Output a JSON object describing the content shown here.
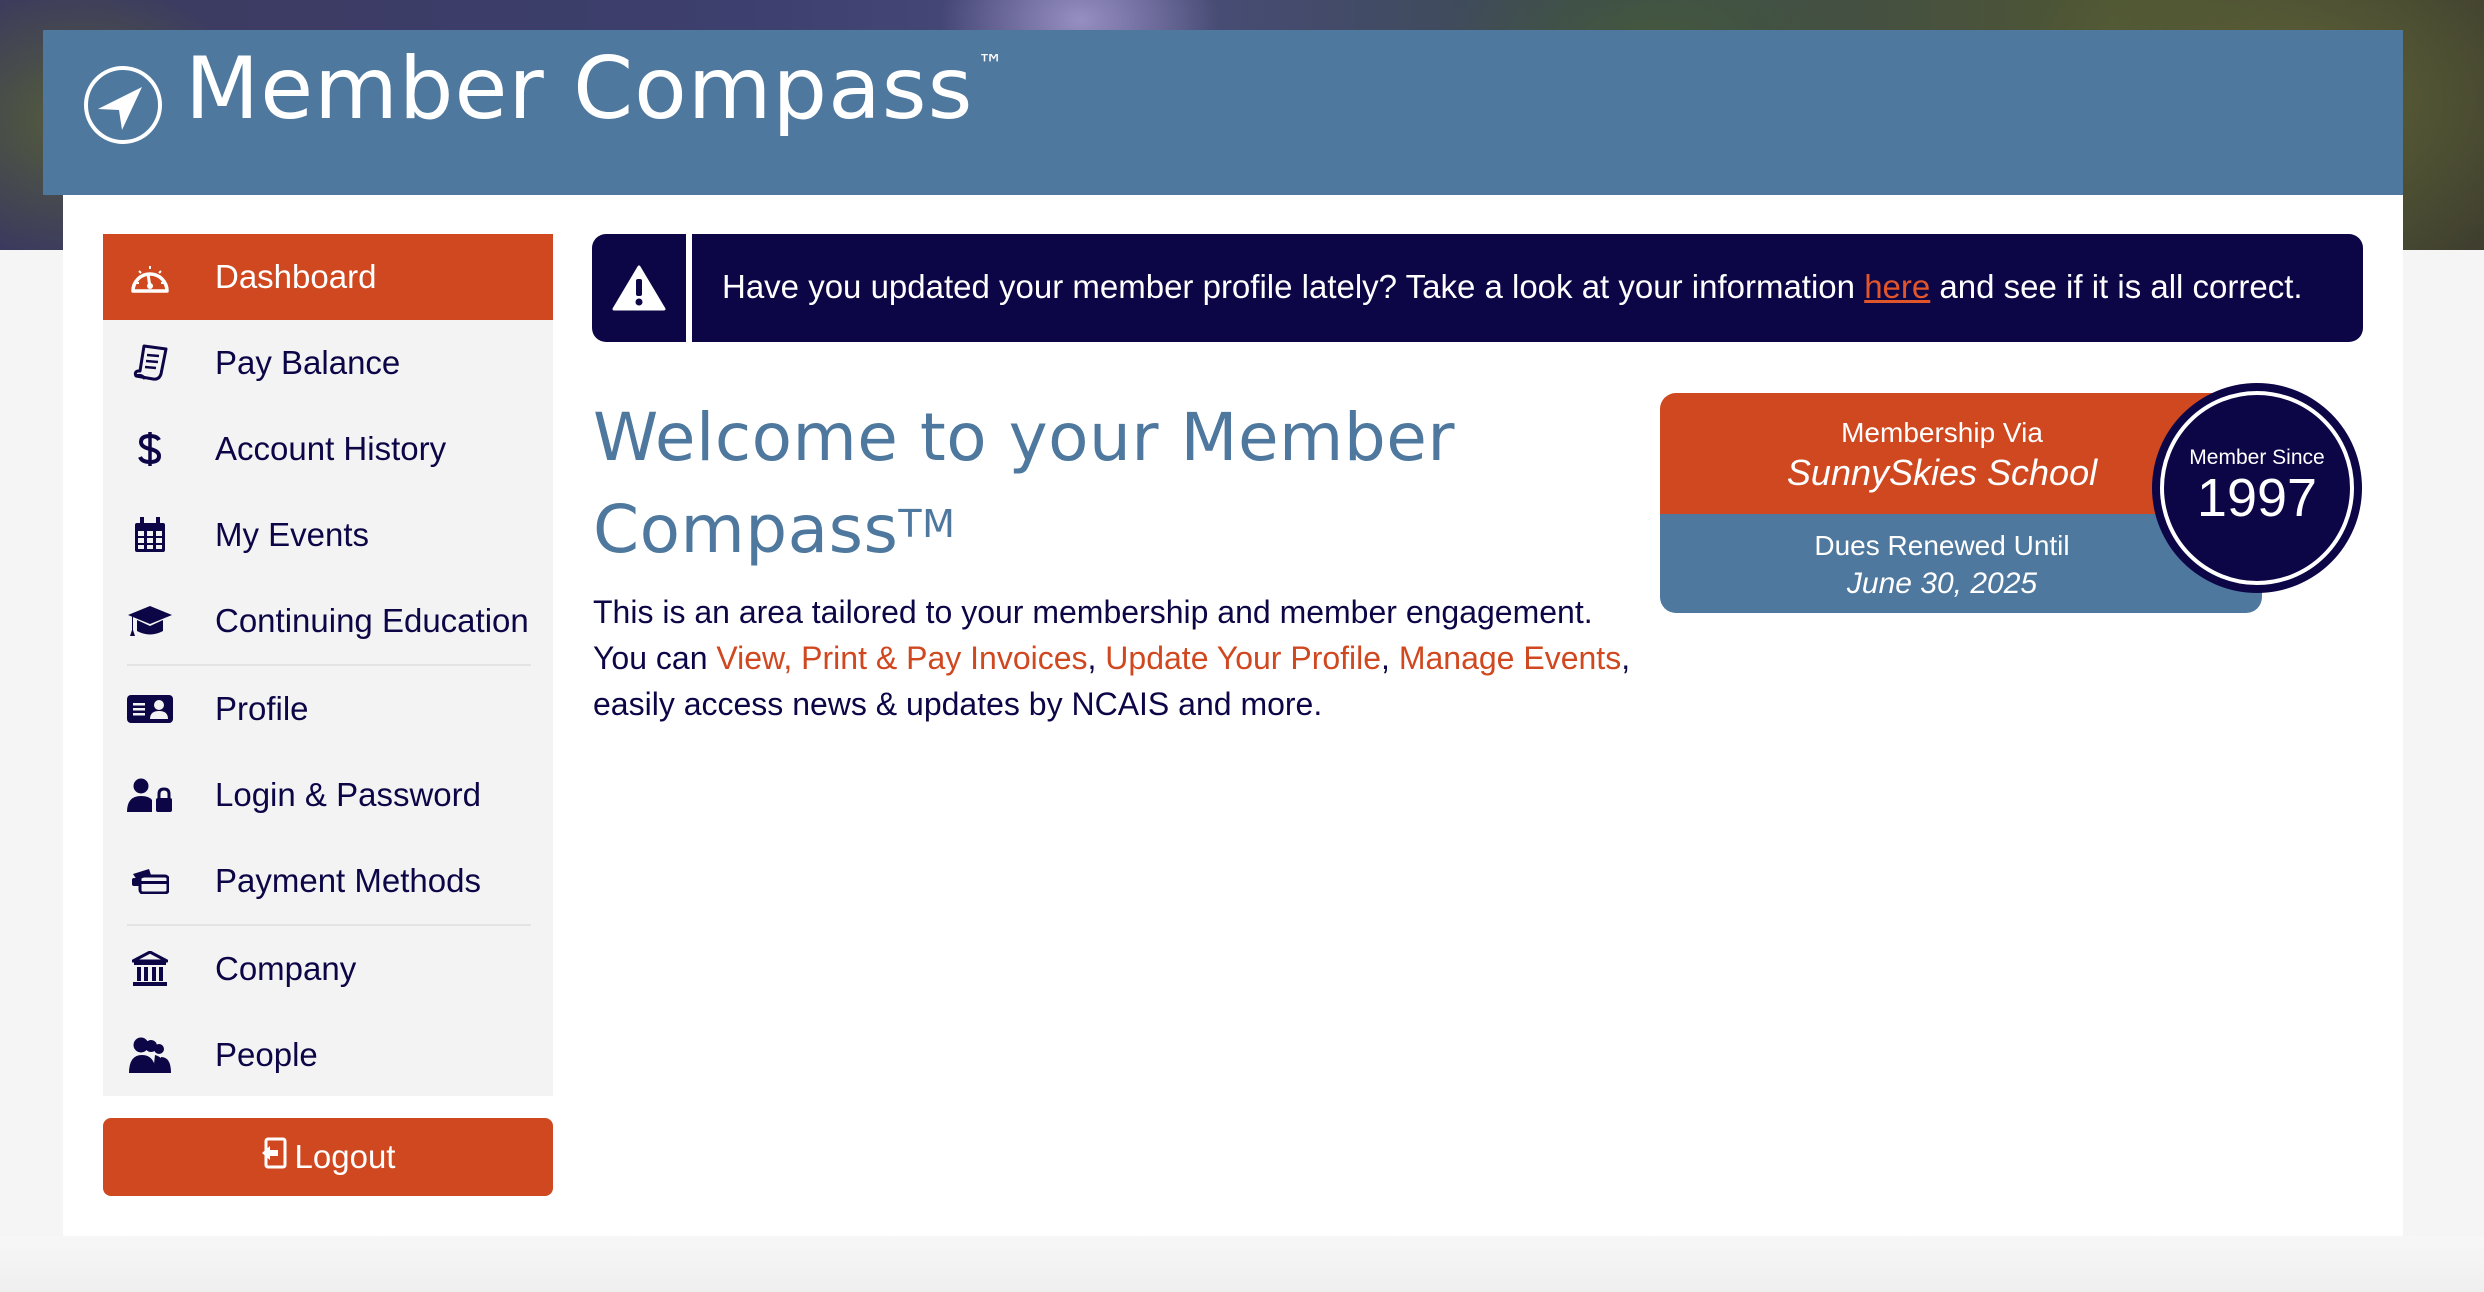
{
  "app": {
    "brand_name": "Member Compass",
    "brand_mark": "™",
    "logo_icon": "compass-arrow-icon"
  },
  "sidebar": {
    "items": [
      {
        "label": "Dashboard",
        "icon": "dashboard-gauge-icon",
        "active": true
      },
      {
        "label": "Pay Balance",
        "icon": "receipt-icon",
        "active": false
      },
      {
        "label": "Account History",
        "icon": "dollar-icon",
        "active": false
      },
      {
        "label": "My Events",
        "icon": "calendar-icon",
        "active": false
      },
      {
        "label": "Continuing Education",
        "icon": "graduation-cap-icon",
        "active": false
      },
      {
        "label": "Profile",
        "icon": "id-card-icon",
        "active": false
      },
      {
        "label": "Login & Password",
        "icon": "user-lock-icon",
        "active": false
      },
      {
        "label": "Payment Methods",
        "icon": "credit-cards-icon",
        "active": false
      },
      {
        "label": "Company",
        "icon": "bank-building-icon",
        "active": false
      },
      {
        "label": "People",
        "icon": "people-icon",
        "active": false
      }
    ],
    "logout_label": "Logout",
    "logout_icon": "logout-icon"
  },
  "alert": {
    "icon": "warning-triangle-icon",
    "text_before": "Have you updated your member profile lately? Take a look at your information",
    "link_text": "here",
    "text_after": "and see if it is all correct."
  },
  "welcome": {
    "title_line1": "Welcome to your Member",
    "title_line2": "Compass",
    "title_mark": "TM",
    "intro": "This is an area tailored to your membership and member engagement.",
    "you_can": "You can",
    "links": [
      "View, Print & Pay Invoices",
      "Update Your Profile",
      "Manage Events"
    ],
    "outro": "easily access news & updates by NCAIS and more."
  },
  "membership_card": {
    "via_label": "Membership Via",
    "via_value": "SunnySkies School",
    "dues_label": "Dues Renewed Until",
    "dues_value": "June 30, 2025",
    "since_label": "Member Since",
    "since_year": "1997"
  },
  "colors": {
    "accent_orange": "#d04820",
    "brand_blue": "#4f789e",
    "navy": "#0c0647",
    "sidebar_bg": "#f3f3f3"
  }
}
